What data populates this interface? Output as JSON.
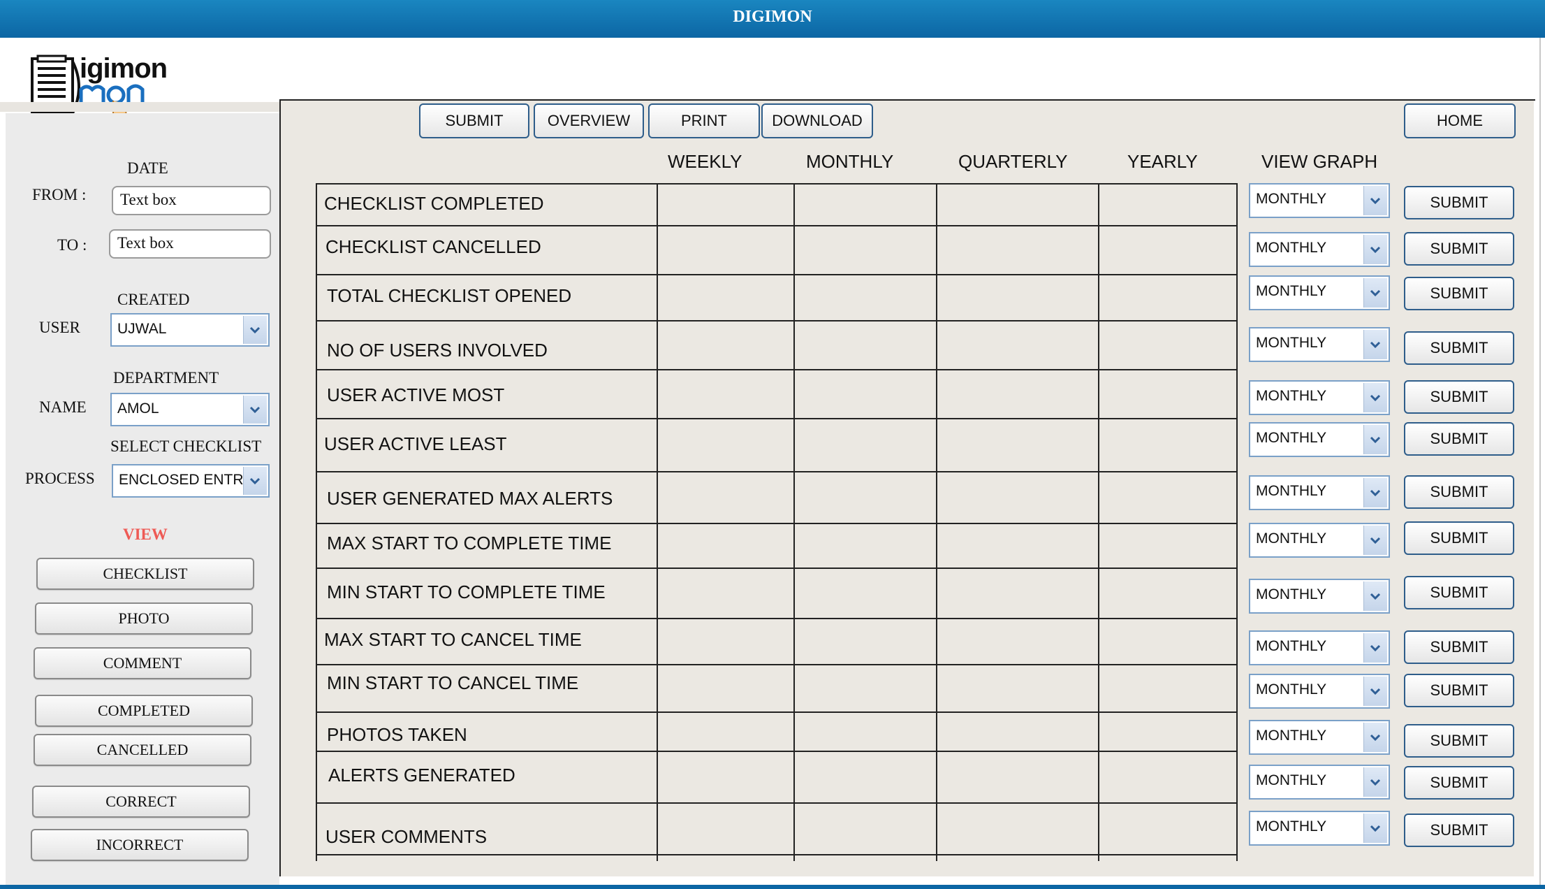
{
  "app": {
    "title": "DIGIMON",
    "logo_text": "igimon"
  },
  "sidebar": {
    "date_label": "DATE",
    "from_label": "FROM :",
    "from_value": "Text box",
    "to_label": "TO :",
    "to_value": "Text box",
    "created_label": "CREATED",
    "user_label": "USER",
    "user_value": "UJWAL",
    "department_label": "DEPARTMENT",
    "name_label": "NAME",
    "name_value": "AMOL",
    "select_checklist_label": "SELECT CHECKLIST",
    "process_label": "PROCESS",
    "process_value": "ENCLOSED ENTRY",
    "view_label": "VIEW",
    "view_color": "#ee5a55",
    "buttons": [
      "CHECKLIST",
      "PHOTO",
      "COMMENT",
      "COMPLETED",
      "CANCELLED",
      "CORRECT",
      "INCORRECT"
    ]
  },
  "toolbar": {
    "submit": "SUBMIT",
    "overview": "OVERVIEW",
    "print": "PRINT",
    "download": "DOWNLOAD",
    "home": "HOME"
  },
  "table": {
    "columns": [
      "WEEKLY",
      "MONTHLY",
      "QUARTERLY",
      "YEARLY",
      "VIEW GRAPH"
    ],
    "rows": [
      {
        "label": "CHECKLIST COMPLETED",
        "graph_period": "MONTHLY",
        "submit": "SUBMIT"
      },
      {
        "label": "CHECKLIST CANCELLED",
        "graph_period": "MONTHLY",
        "submit": "SUBMIT"
      },
      {
        "label": "TOTAL CHECKLIST OPENED",
        "graph_period": "MONTHLY",
        "submit": "SUBMIT"
      },
      {
        "label": "NO OF USERS INVOLVED",
        "graph_period": "MONTHLY",
        "submit": "SUBMIT"
      },
      {
        "label": "USER ACTIVE MOST",
        "graph_period": "MONTHLY",
        "submit": "SUBMIT"
      },
      {
        "label": "USER ACTIVE LEAST",
        "graph_period": "MONTHLY",
        "submit": "SUBMIT"
      },
      {
        "label": "USER GENERATED MAX ALERTS",
        "graph_period": "MONTHLY",
        "submit": "SUBMIT"
      },
      {
        "label": "MAX START TO COMPLETE TIME",
        "graph_period": "MONTHLY",
        "submit": "SUBMIT"
      },
      {
        "label": "MIN START TO COMPLETE TIME",
        "graph_period": "MONTHLY",
        "submit": "SUBMIT"
      },
      {
        "label": "MAX START TO CANCEL TIME",
        "graph_period": "MONTHLY",
        "submit": "SUBMIT"
      },
      {
        "label": "MIN START TO CANCEL TIME",
        "graph_period": "MONTHLY",
        "submit": "SUBMIT"
      },
      {
        "label": "PHOTOS TAKEN",
        "graph_period": "MONTHLY",
        "submit": "SUBMIT"
      },
      {
        "label": "ALERTS GENERATED",
        "graph_period": "MONTHLY",
        "submit": "SUBMIT"
      },
      {
        "label": "USER COMMENTS",
        "graph_period": "MONTHLY",
        "submit": "SUBMIT"
      }
    ]
  }
}
